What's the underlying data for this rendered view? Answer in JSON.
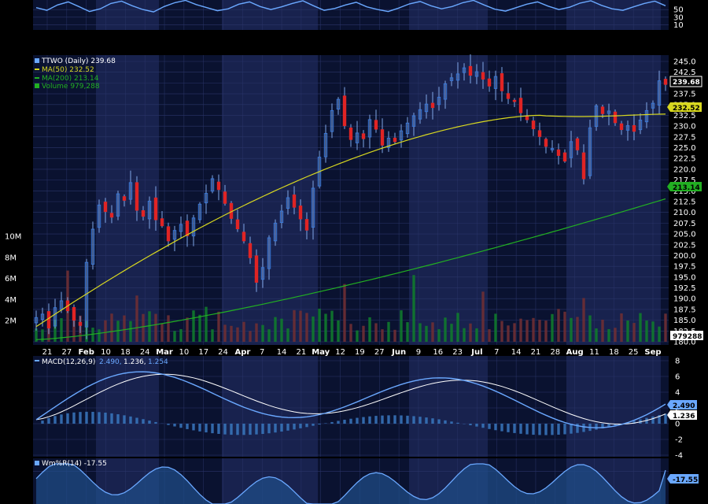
{
  "colors": {
    "background": "#000000",
    "panel_band_dark": "#0a1230",
    "panel_band_light": "#18224e",
    "grid": "#2a3568",
    "candle_up": "#3a78d8",
    "candle_down": "#e02424",
    "wick": "#7fa6e6",
    "ma50": "#d8d820",
    "ma200": "#22b022",
    "volume_up": "#0f7a2e",
    "volume_down": "#6e2f34",
    "macd_line": "#6aa8ff",
    "signal_line": "#ffffff",
    "histogram": "#3a78c0",
    "williams": "#6aa8ff"
  },
  "top_panel": {
    "ticks": [
      "50",
      "30",
      "10"
    ],
    "values": [
      55,
      48,
      62,
      70,
      58,
      45,
      52,
      66,
      72,
      60,
      50,
      44,
      58,
      68,
      74,
      63,
      55,
      47,
      52,
      64,
      70,
      58,
      50,
      57,
      66,
      73,
      60,
      48,
      53,
      62,
      69,
      57,
      50,
      45,
      54,
      65,
      71,
      60,
      52,
      58,
      68,
      74,
      62,
      51,
      46,
      55,
      64,
      70,
      59,
      50,
      56,
      67,
      73,
      61,
      52,
      48,
      57,
      66,
      72,
      60
    ]
  },
  "main_panel": {
    "legend": {
      "ticker": "TTWO (Daily) 239.68",
      "ma50": "MA(50) 232.52",
      "ma200": "MA(200) 213.14",
      "volume": "Volume 979,288"
    },
    "price_ticks": [
      "245.0",
      "242.5",
      "240.0",
      "237.5",
      "235.0",
      "232.5",
      "230.0",
      "227.5",
      "225.0",
      "222.5",
      "220.0",
      "217.5",
      "215.0",
      "212.5",
      "210.0",
      "207.5",
      "205.0",
      "202.5",
      "200.0",
      "197.5",
      "195.0",
      "192.5",
      "190.0",
      "187.5",
      "185.0",
      "182.5",
      "180.0"
    ],
    "volume_ticks": [
      "10M",
      "8M",
      "6M",
      "4M",
      "2M"
    ],
    "badges": {
      "last": "239.68",
      "ma50": "232.52",
      "ma200": "213.14",
      "volume": "979288"
    },
    "x_labels": [
      "21",
      "27",
      "Feb",
      "10",
      "18",
      "24",
      "Mar",
      "10",
      "17",
      "24",
      "Apr",
      "7",
      "14",
      "21",
      "May",
      "12",
      "19",
      "27",
      "Jun",
      "9",
      "16",
      "23",
      "Jul",
      "7",
      "14",
      "21",
      "28",
      "Aug",
      "11",
      "18",
      "25",
      "Sep"
    ],
    "month_labels": [
      "Feb",
      "Mar",
      "Apr",
      "May",
      "Jun",
      "Jul",
      "Aug",
      "Sep"
    ]
  },
  "macd_panel": {
    "legend_label": "MACD(12,26,9)",
    "legend_macd": "2.490,",
    "legend_signal": "1.236,",
    "legend_hist": "1.254",
    "ticks": [
      "8",
      "6",
      "4",
      "2",
      "0",
      "-2",
      "-4"
    ],
    "badges": {
      "macd": "2.490",
      "signal": "1.236"
    }
  },
  "williams_panel": {
    "legend": "Wm%R(14) -17.55",
    "badge": "-17.55"
  },
  "chart_data": {
    "type": "line",
    "title": "TTWO (Daily) 239.68",
    "x_range": [
      "Jan 21",
      "Sep 5"
    ],
    "y_range": [
      180,
      245
    ],
    "price_series": {
      "name": "TTWO (Daily)",
      "close": [
        185.6,
        186.4,
        183.2,
        187.9,
        189.5,
        187.2,
        185.0,
        183.8,
        198.4,
        206.1,
        211.7,
        210.2,
        208.9,
        214.3,
        212.8,
        216.9,
        210.5,
        209.1,
        212.6,
        208.3,
        206.9,
        203.4,
        205.8,
        207.2,
        204.6,
        208.7,
        211.9,
        214.4,
        217.8,
        215.3,
        212.1,
        208.6,
        206.2,
        203.4,
        199.5,
        193.8,
        197.2,
        204.1,
        207.5,
        210.3,
        213.4,
        211.2,
        208.5,
        205.9,
        215.6,
        222.8,
        228.3,
        233.6,
        236.2,
        230.1,
        226.9,
        228.4,
        227.1,
        231.5,
        229.3,
        225.6,
        227.2,
        226.4,
        228.9,
        230.7,
        232.4,
        233.8,
        235.1,
        234.3,
        236.7,
        239.8,
        241.2,
        242.1,
        243.5,
        241.8,
        242.6,
        240.9,
        239.3,
        241.5,
        238.2,
        236.4,
        235.7,
        233.1,
        231.5,
        229.4,
        227.6,
        225.3,
        224.8,
        223.2,
        221.9,
        226.4,
        224.5,
        217.8,
        229.6,
        234.7,
        232.9,
        233.5,
        230.8,
        229.2,
        230.1,
        228.8,
        231.4,
        233.6,
        235.3,
        240.5,
        239.68
      ]
    },
    "ma50": {
      "name": "MA(50)",
      "start": 183.5,
      "end": 232.52
    },
    "ma200": {
      "name": "MA(200)",
      "start": 180.5,
      "end": 213.14
    },
    "volume": {
      "name": "Volume",
      "last": 979288,
      "ylim": [
        0,
        10000000
      ]
    },
    "macd": {
      "name": "MACD(12,26,9)",
      "macd_last": 2.49,
      "signal_last": 1.236,
      "histogram_last": 1.254,
      "ylim": [
        -4,
        8
      ]
    },
    "williams_r": {
      "name": "Wm%R(14)",
      "last": -17.55
    }
  }
}
